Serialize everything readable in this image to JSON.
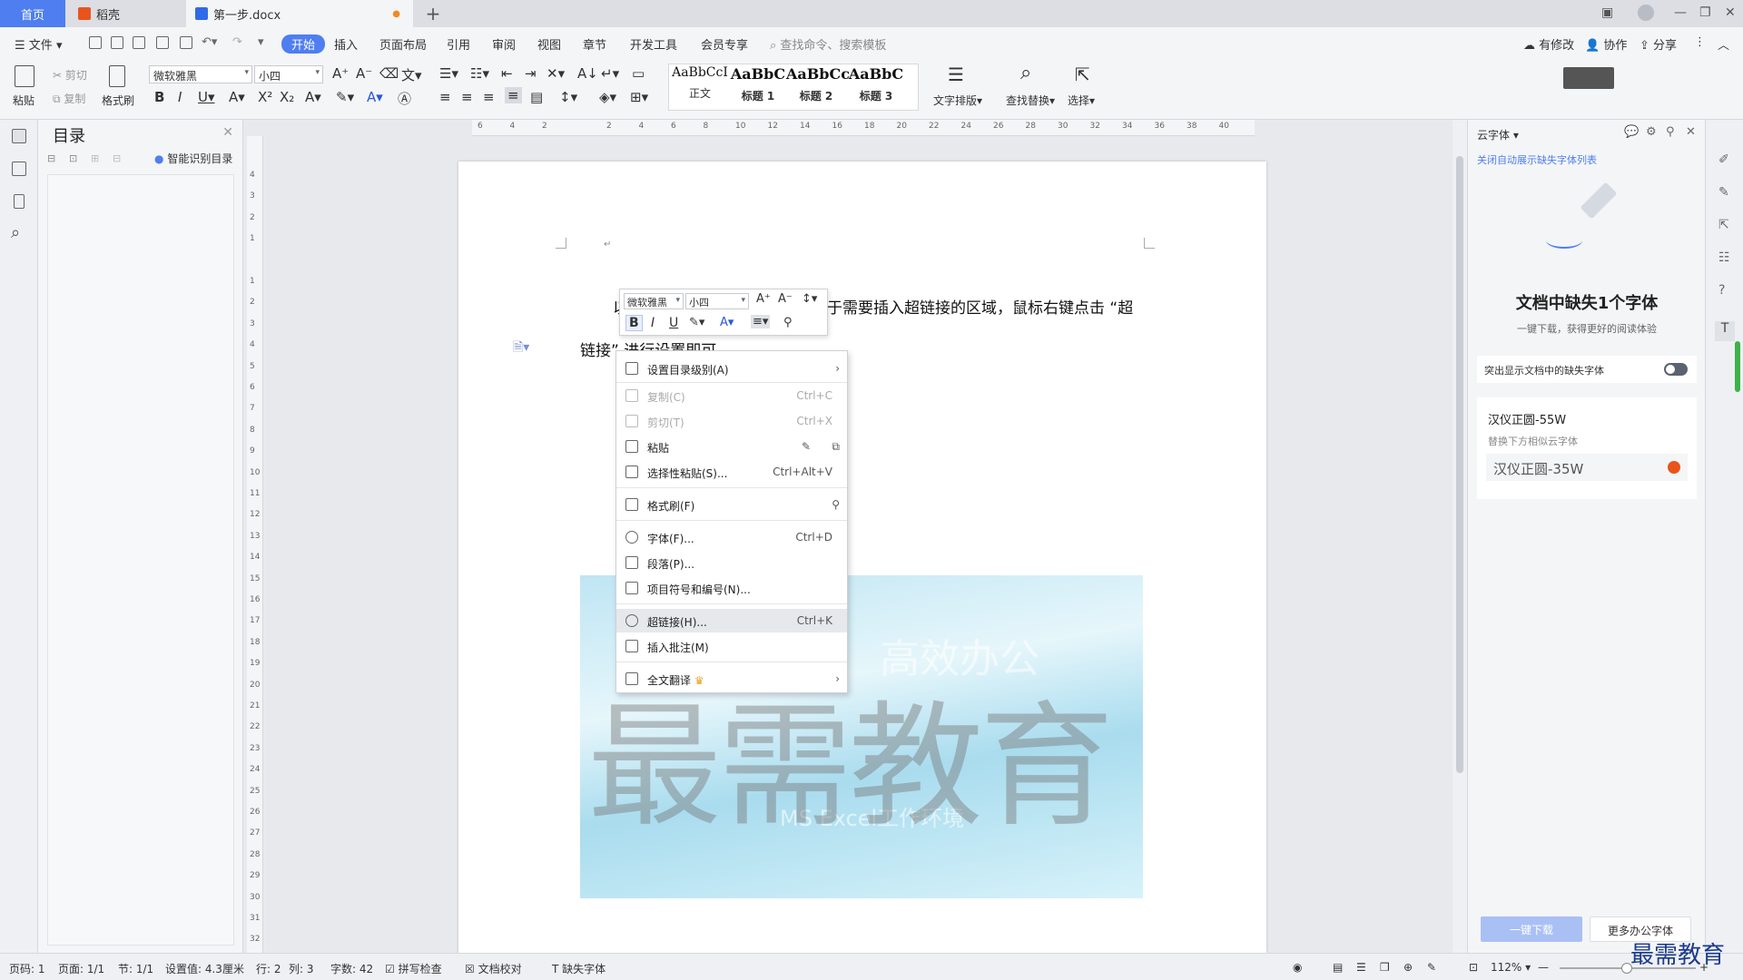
{
  "tabs": {
    "home": "首页",
    "daoke": "稻壳",
    "doc": "第一步.docx"
  },
  "menubar": {
    "file": "文件",
    "items": [
      "开始",
      "插入",
      "页面布局",
      "引用",
      "审阅",
      "视图",
      "章节",
      "开发工具",
      "会员专享"
    ],
    "search": "查找命令、搜索模板",
    "right": {
      "changes": "有修改",
      "collab": "协作",
      "share": "分享"
    }
  },
  "ribbon": {
    "paste": "粘贴",
    "cut": "剪切",
    "copy": "复制",
    "format_painter": "格式刷",
    "font_name": "微软雅黑",
    "font_size": "小四",
    "styles": [
      {
        "preview": "AaBbCcI",
        "label": "正文"
      },
      {
        "preview": "AaBbC",
        "label": "标题 1"
      },
      {
        "preview": "AaBbCc",
        "label": "标题 2"
      },
      {
        "preview": "AaBbC",
        "label": "标题 3"
      }
    ],
    "text_layout": "文字排版",
    "find_replace": "查找替换",
    "select": "选择"
  },
  "nav": {
    "title": "目录",
    "smart": "智能识别目录"
  },
  "ruler_h": [
    "6",
    "4",
    "2",
    "",
    "2",
    "4",
    "6",
    "8",
    "10",
    "12",
    "14",
    "16",
    "18",
    "20",
    "22",
    "24",
    "26",
    "28",
    "30",
    "32",
    "34",
    "36",
    "38",
    "40"
  ],
  "ruler_v": [
    "4",
    "3",
    "2",
    "1",
    "",
    "1",
    "2",
    "3",
    "4",
    "5",
    "6",
    "7",
    "8",
    "9",
    "10",
    "11",
    "12",
    "13",
    "14",
    "15",
    "16",
    "17",
    "18",
    "19",
    "20",
    "21",
    "22",
    "23",
    "24",
    "25",
    "26",
    "27",
    "28",
    "29",
    "30",
    "31",
    "32"
  ],
  "document": {
    "line1_prefix": "以",
    "line1_suffix": "于需要插入超链接的区域，鼠标右键点击 “超",
    "line2": "链接” 进行设置即可。",
    "image_title": "高效办公",
    "image_subtitle": "MS Excel工作环境",
    "watermark": "最需教育"
  },
  "minibar": {
    "font": "微软雅黑",
    "size": "小四"
  },
  "context_menu": [
    {
      "label": "设置目录级别(A)",
      "shortcut": "",
      "arrow": true,
      "disabled": false,
      "icon": "toc-level-icon"
    },
    {
      "label": "复制(C)",
      "shortcut": "Ctrl+C",
      "disabled": true,
      "icon": "copy-icon"
    },
    {
      "label": "剪切(T)",
      "shortcut": "Ctrl+X",
      "disabled": true,
      "icon": "scissors-icon"
    },
    {
      "label": "粘贴",
      "shortcut": "",
      "disabled": false,
      "icon": "paste-icon"
    },
    {
      "label": "选择性粘贴(S)...",
      "shortcut": "Ctrl+Alt+V",
      "disabled": false,
      "icon": "paste-special-icon"
    },
    {
      "label": "格式刷(F)",
      "shortcut": "",
      "disabled": false,
      "icon": "format-painter-icon"
    },
    {
      "label": "字体(F)...",
      "shortcut": "Ctrl+D",
      "disabled": false,
      "icon": "font-icon"
    },
    {
      "label": "段落(P)...",
      "shortcut": "",
      "disabled": false,
      "icon": "paragraph-icon"
    },
    {
      "label": "项目符号和编号(N)...",
      "shortcut": "",
      "disabled": false,
      "icon": "list-icon"
    },
    {
      "label": "超链接(H)...",
      "shortcut": "Ctrl+K",
      "disabled": false,
      "icon": "link-icon"
    },
    {
      "label": "插入批注(M)",
      "shortcut": "",
      "disabled": false,
      "icon": "comment-icon"
    },
    {
      "label": "全文翻译",
      "shortcut": "",
      "arrow": true,
      "disabled": false,
      "icon": "translate-icon"
    }
  ],
  "right_panel": {
    "header": "云字体",
    "close_list": "关闭自动展示缺失字体列表",
    "missing_title": "文档中缺失1个字体",
    "missing_sub": "一键下载，获得更好的阅读体验",
    "toggle_label": "突出显示文档中的缺失字体",
    "font_missing": "汉仪正圆-55W",
    "replace_hint": "替换下方相似云字体",
    "font_replacement": "汉仪正圆-35W",
    "download_btn": "一键下载",
    "more_fonts": "更多办公字体"
  },
  "status": {
    "page_num": "页码: 1",
    "pages": "页面: 1/1",
    "section": "节: 1/1",
    "setting": "设置值: 4.3厘米",
    "row": "行: 2",
    "col": "列: 3",
    "words": "字数: 42",
    "spell": "拼写检查",
    "proof": "文档校对",
    "missing_font": "缺失字体",
    "zoom": "112%"
  },
  "brand": "最需教育",
  "colors": {
    "accent": "#4e7ef0",
    "toggle_off": "#5b6270",
    "danger": "#e8541c"
  }
}
